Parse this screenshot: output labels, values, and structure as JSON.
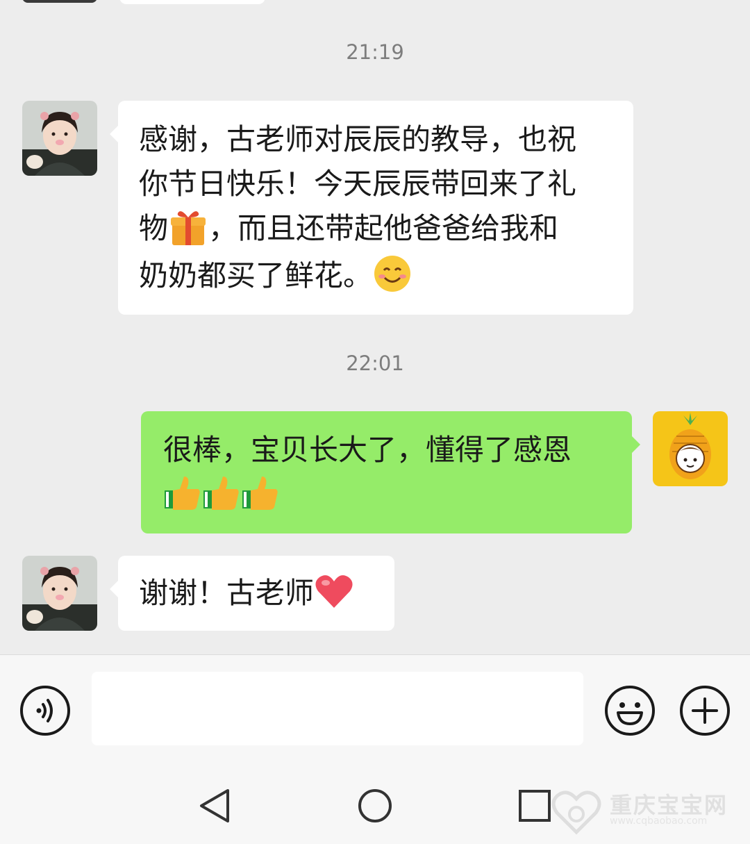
{
  "messages": [
    {
      "timestamp": "21:19",
      "sender": "contact",
      "lines": [
        "感谢，古老师对辰辰的教导，也祝",
        "你节日快乐！今天辰辰带回来了礼"
      ],
      "line3_a": "物",
      "line3_b": "，而且还带起他爸爸给我和",
      "line4": "奶奶都买了鲜花。",
      "emojis": [
        "gift-emoji",
        "smile-emoji"
      ]
    },
    {
      "timestamp": "22:01",
      "sender": "me",
      "line1": "很棒，宝贝长大了，懂得了感恩",
      "emojis": [
        "thumbs-up-emoji",
        "thumbs-up-emoji",
        "thumbs-up-emoji"
      ]
    },
    {
      "sender": "contact",
      "text": "谢谢！古老师",
      "emojis": [
        "heart-emoji"
      ]
    }
  ],
  "input_bar": {
    "placeholder": "",
    "icons": [
      "voice-icon",
      "emoji-icon",
      "plus-icon"
    ]
  },
  "nav_bar": {
    "icons": [
      "back-icon",
      "home-icon",
      "recents-icon"
    ]
  },
  "watermark": {
    "title": "重庆宝宝网",
    "url": "www.cqbaobao.com"
  },
  "colors": {
    "background": "#ededed",
    "my_bubble": "#95ec69",
    "their_bubble": "#ffffff",
    "timestamp": "#7d7d7d"
  }
}
